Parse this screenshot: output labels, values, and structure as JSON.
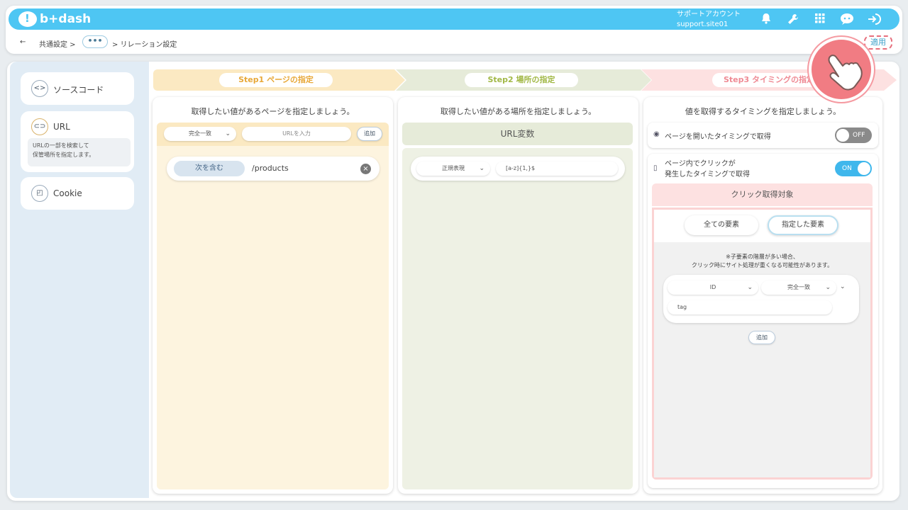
{
  "header": {
    "logo_text": "b+dash",
    "account_name": "サポートアカウント",
    "account_site": "support.site01",
    "breadcrumb_back": "←",
    "breadcrumb_common": "共通設定 >",
    "breadcrumb_more": "•••",
    "breadcrumb_current": "> リレーション設定",
    "apply_label": "適用"
  },
  "sidebar": {
    "items": [
      {
        "label": "ソースコード",
        "icon": "code-icon"
      },
      {
        "label": "URL",
        "icon": "link-icon",
        "description_line1": "URLの一部を検索して",
        "description_line2": "保管場所を指定します。"
      },
      {
        "label": "Cookie",
        "icon": "cookie-icon"
      }
    ]
  },
  "steps": [
    {
      "label": "Step1 ページの指定",
      "color": "#fbe9c2",
      "text_color": "#e8a838"
    },
    {
      "label": "Step2 場所の指定",
      "color": "#e6ebd9",
      "text_color": "#a1b845"
    },
    {
      "label": "Step3 タイミングの指定",
      "color": "#fde1e1",
      "text_color": "#ef8a94"
    }
  ],
  "step1": {
    "title": "取得したい値があるページを指定しましょう。",
    "match_select": "完全一致",
    "url_placeholder": "URLを入力",
    "add_label": "追加",
    "rule_type": "次を含む",
    "rule_value": "/products"
  },
  "step2": {
    "title": "取得したい値がある場所を指定しましょう。",
    "header": "URL変数",
    "method_select": "正規表現",
    "pattern_value": "[a-z]{1,}$"
  },
  "step3": {
    "title": "値を取得するタイミングを指定しましょう。",
    "open_timing_label": "ページを開いたタイミングで取得",
    "open_toggle": "OFF",
    "click_timing_line1": "ページ内でクリックが",
    "click_timing_line2": "発生したタイミングで取得",
    "click_toggle": "ON",
    "click_target_header": "クリック取得対象",
    "all_elements": "全ての要素",
    "specified_elements": "指定した要素",
    "note_line1": "※子要素の階層が多い場合、",
    "note_line2": "クリック時にサイト処理が重くなる可能性があります。",
    "attr_select": "ID",
    "attr_match_select": "完全一致",
    "attr_value": "tag",
    "add_label": "追加"
  }
}
